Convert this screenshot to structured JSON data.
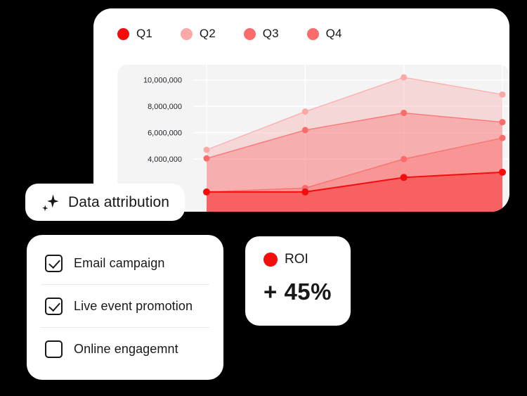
{
  "colors": {
    "q1": "#F50C0C",
    "q2": "#FBA8A8",
    "q3": "#FA6B6B",
    "q4": "#FA6B6B",
    "roi_dot": "#F50C0C",
    "card_bg": "#FFFFFF",
    "plot_bg": "#F4F4F5",
    "gridline": "#FFFFFF",
    "text": "#17181A",
    "background": "#000000"
  },
  "chart_card": {
    "legend": [
      {
        "label": "Q1",
        "color": "#F50C0C",
        "icon": "legend-dot-q1"
      },
      {
        "label": "Q2",
        "color": "#FBA8A8",
        "icon": "legend-dot-q2"
      },
      {
        "label": "Q3",
        "color": "#FA6B6B",
        "icon": "legend-dot-q3"
      },
      {
        "label": "Q4",
        "color": "#FA6B6B",
        "icon": "legend-dot-q4"
      }
    ]
  },
  "chart_data": {
    "type": "area",
    "title": "",
    "xlabel": "",
    "ylabel": "",
    "ylim": [
      0,
      11000000
    ],
    "yticks": [
      4000000,
      6000000,
      8000000,
      10000000
    ],
    "ytick_labels": [
      "4,000,000",
      "6,000,000",
      "8,000,000",
      "10,000,000"
    ],
    "grid": true,
    "grid_orientation": "both",
    "legend_position": "top-left",
    "x": [
      1,
      2,
      3,
      4
    ],
    "categories": [
      "",
      "",
      "",
      ""
    ],
    "stacked": true,
    "series": [
      {
        "name": "Q1",
        "color": "#F50C0C",
        "values": [
          1500000,
          1500000,
          2600000,
          3000000
        ]
      },
      {
        "name": "Q4",
        "color": "#FA6B6B",
        "values": [
          1500000,
          1800000,
          4000000,
          5600000
        ]
      },
      {
        "name": "Q3",
        "color": "#FA6B6B",
        "values": [
          4050000,
          6200000,
          7500000,
          6800000
        ]
      },
      {
        "name": "Q2",
        "color": "#FBA8A8",
        "values": [
          4700000,
          7600000,
          10200000,
          8900000
        ]
      }
    ]
  },
  "attribution_card": {
    "icon": "sparkle-icon",
    "label": "Data attribution"
  },
  "checklist_card": {
    "items": [
      {
        "label": "Email campaign",
        "checked": true
      },
      {
        "label": "Live event promotion",
        "checked": true
      },
      {
        "label": "Online engagemnt",
        "checked": false
      }
    ]
  },
  "roi_card": {
    "label": "ROI",
    "value": "+ 45%",
    "dot_color": "#F50C0C"
  }
}
